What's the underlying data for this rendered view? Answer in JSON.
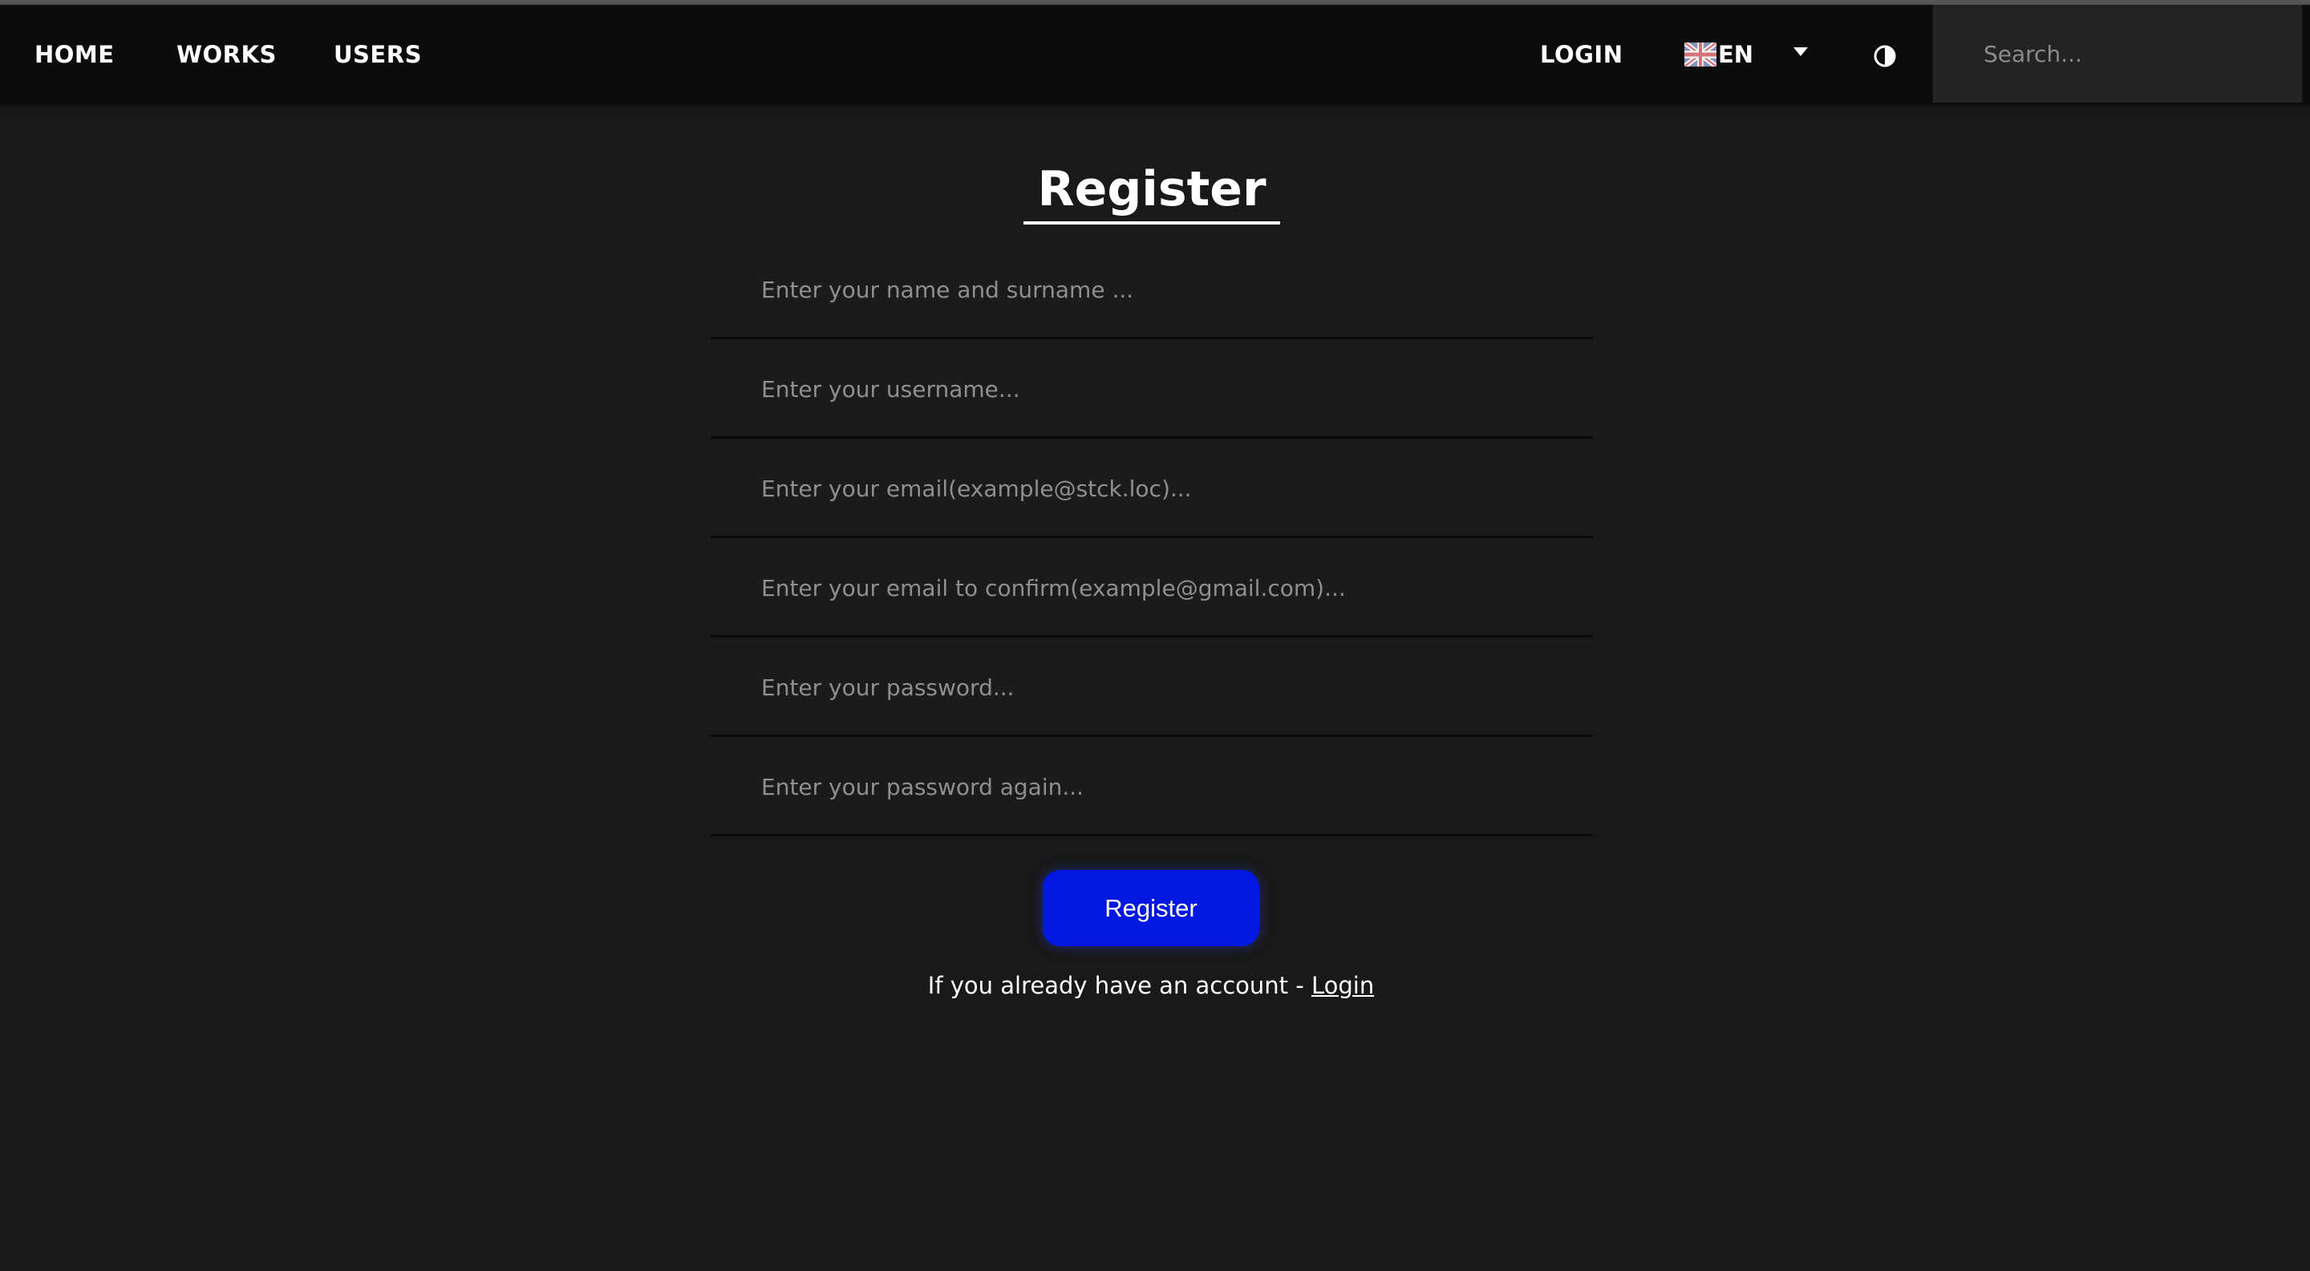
{
  "nav": {
    "home": "HOME",
    "works": "WORKS",
    "users": "USERS",
    "login": "LOGIN"
  },
  "language": {
    "code": "EN",
    "flag_icon": "uk-flag-icon",
    "dropdown_icon": "caret-down-icon"
  },
  "theme_toggle_icon": "contrast-icon",
  "search": {
    "placeholder": "Search...",
    "value": ""
  },
  "page": {
    "title": "Register"
  },
  "form": {
    "fields": [
      {
        "placeholder": "Enter your name and surname ...",
        "value": ""
      },
      {
        "placeholder": "Enter your username...",
        "value": ""
      },
      {
        "placeholder": "Enter your email(example@stck.loc)...",
        "value": ""
      },
      {
        "placeholder": "Enter your email to confirm(example@gmail.com)...",
        "value": ""
      },
      {
        "placeholder": "Enter your password...",
        "value": ""
      },
      {
        "placeholder": "Enter your password again...",
        "value": ""
      }
    ],
    "submit_label": "Register"
  },
  "footer_prompt": {
    "text": "If you already have an account - ",
    "link_label": "Login"
  },
  "colors": {
    "background": "#191919",
    "navbar": "#0c0c0c",
    "accent_button": "#0018e0",
    "text": "#ffffff",
    "placeholder": "#8f8f8f"
  }
}
